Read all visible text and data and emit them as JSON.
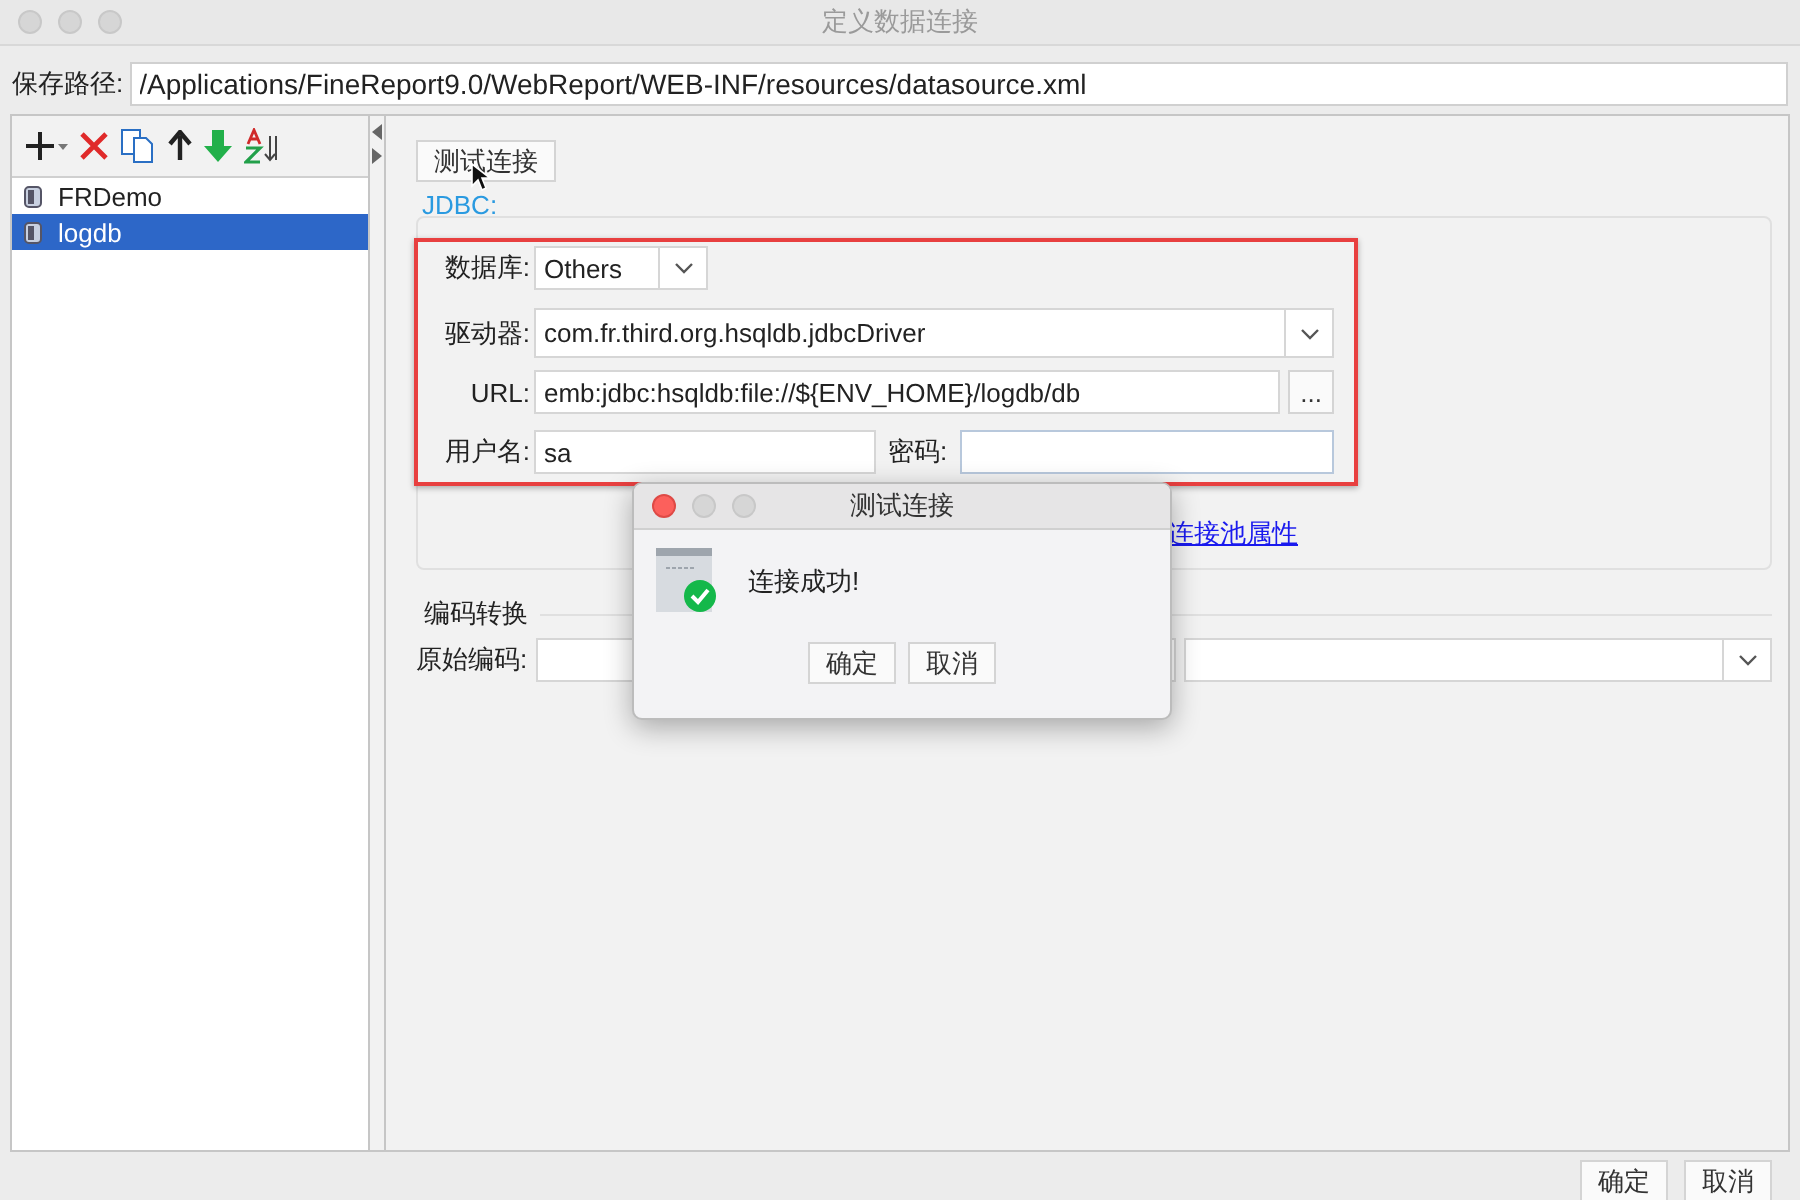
{
  "window": {
    "title": "定义数据连接"
  },
  "save_path": {
    "label": "保存路径:",
    "value": "/Applications/FineReport9.0/WebReport/WEB-INF/resources/datasource.xml"
  },
  "connections": [
    {
      "name": "FRDemo",
      "selected": false
    },
    {
      "name": "logdb",
      "selected": true
    }
  ],
  "test_button": "测试连接",
  "jdbc": {
    "legend": "JDBC:",
    "database": {
      "label": "数据库:",
      "value": "Others"
    },
    "driver": {
      "label": "驱动器:",
      "value": "com.fr.third.org.hsqldb.jdbcDriver"
    },
    "url": {
      "label": "URL:",
      "value": "emb:jdbc:hsqldb:file://${ENV_HOME}/logdb/db",
      "browse": "..."
    },
    "username": {
      "label": "用户名:",
      "value": "sa"
    },
    "password": {
      "label": "密码:"
    },
    "pool_link": "连接池属性"
  },
  "encoding": {
    "title": "编码转换",
    "label": "原始编码:"
  },
  "dialog": {
    "title": "测试连接",
    "message": "连接成功!",
    "buttons": [
      "确定",
      "取消"
    ]
  },
  "buttons": [
    "确定",
    "取消"
  ]
}
